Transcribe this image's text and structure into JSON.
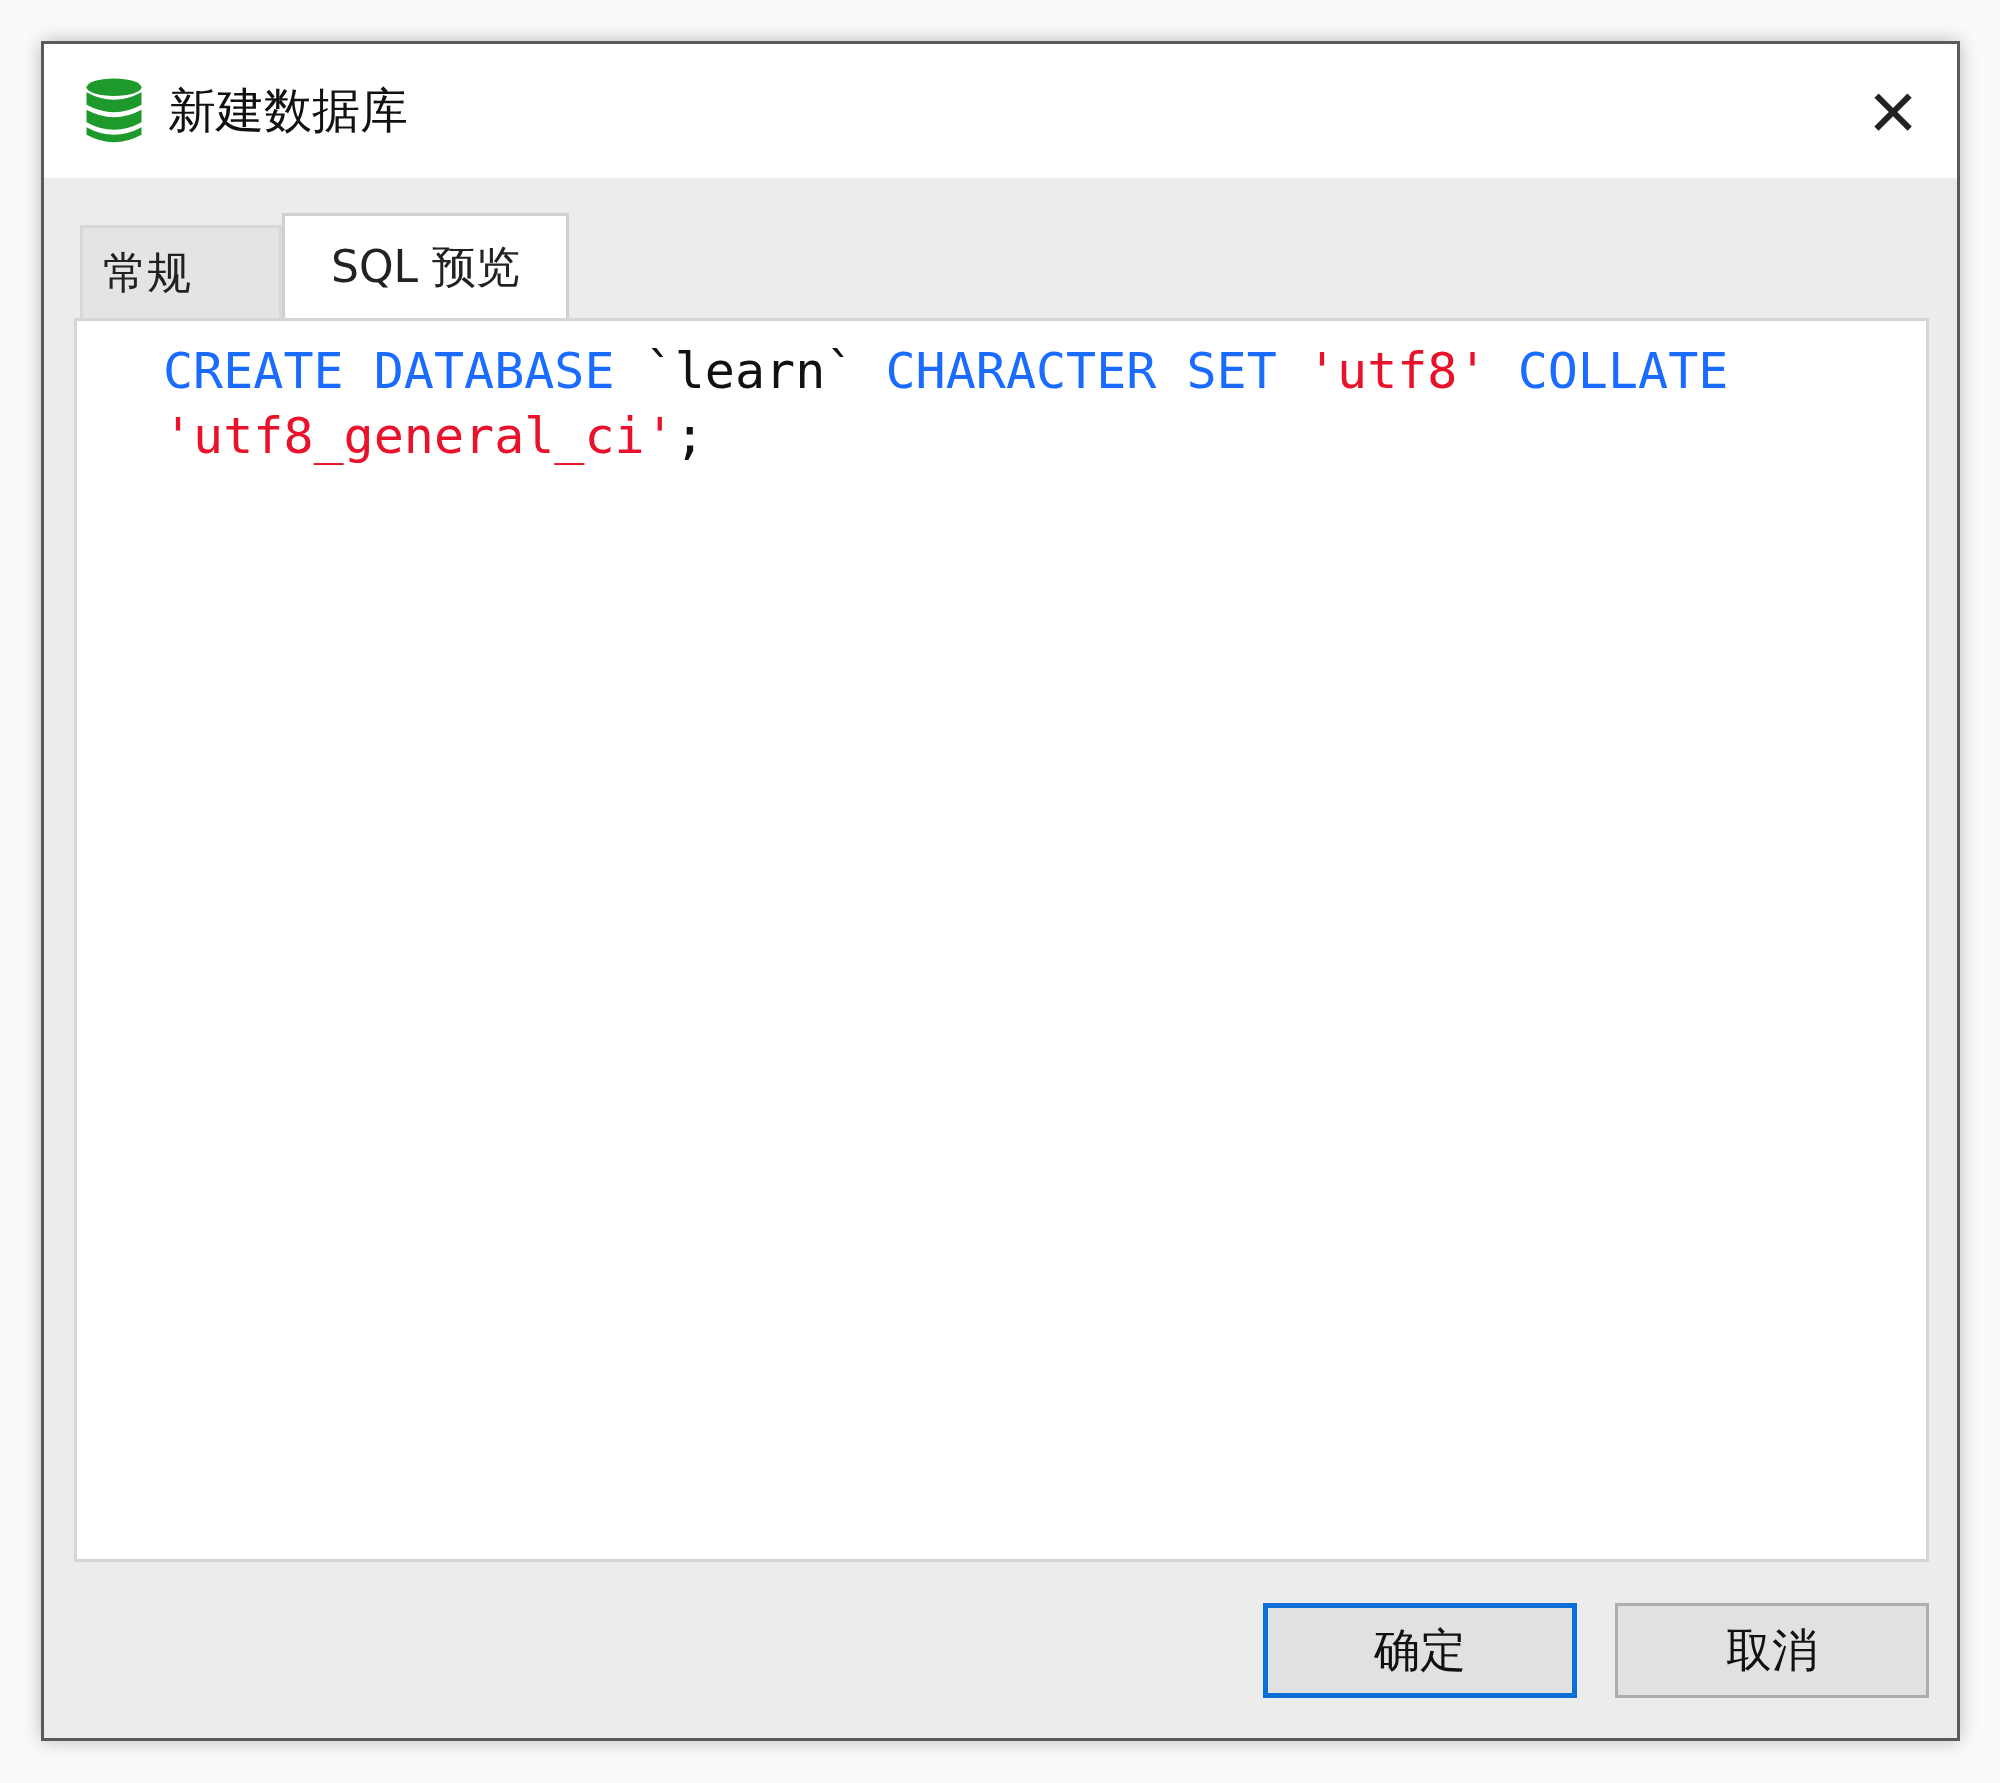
{
  "window": {
    "title": "新建数据库",
    "close": "×"
  },
  "tabs": [
    {
      "label": "常规",
      "selected": false
    },
    {
      "label": "SQL 预览",
      "selected": true
    }
  ],
  "code_lines": [
    [
      {
        "kind": "keyword",
        "text": "CREATE DATABASE"
      },
      {
        "kind": "plain",
        "text": " `learn` "
      },
      {
        "kind": "keyword",
        "text": "CHARACTER SET"
      },
      {
        "kind": "string",
        "text": " 'utf8' "
      },
      {
        "kind": "keyword",
        "text": "COLLATE"
      }
    ],
    [
      {
        "kind": "string",
        "text": "'utf8_general_ci'"
      },
      {
        "kind": "plain",
        "text": ";"
      }
    ]
  ],
  "buttons": [
    {
      "label": "确定",
      "default": true
    },
    {
      "label": "取消",
      "default": false
    }
  ]
}
